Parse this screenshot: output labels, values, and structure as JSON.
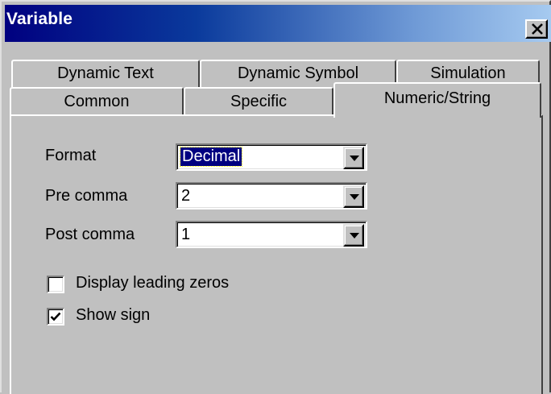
{
  "window": {
    "title": "Variable",
    "close_glyph": "×"
  },
  "tabs": {
    "back_row": [
      {
        "label": "Dynamic Text"
      },
      {
        "label": "Dynamic Symbol"
      },
      {
        "label": "Simulation"
      }
    ],
    "front_row": [
      {
        "label": "Common"
      },
      {
        "label": "Specific"
      },
      {
        "label": "Numeric/String",
        "active": true
      }
    ]
  },
  "form": {
    "format": {
      "label": "Format",
      "value": "Decimal",
      "selected": true
    },
    "pre_comma": {
      "label": "Pre comma",
      "value": "2"
    },
    "post_comma": {
      "label": "Post comma",
      "value": "1"
    },
    "display_leading_zeros": {
      "label": "Display leading zeros",
      "checked": false
    },
    "show_sign": {
      "label": "Show sign",
      "checked": true
    }
  },
  "icons": {
    "close": "close-icon",
    "dropdown": "chevron-down-icon",
    "check": "checkmark-icon"
  },
  "colors": {
    "titlebar_start": "#000080",
    "titlebar_end": "#a6caf0",
    "face": "#c0c0c0",
    "selection": "#000080"
  }
}
